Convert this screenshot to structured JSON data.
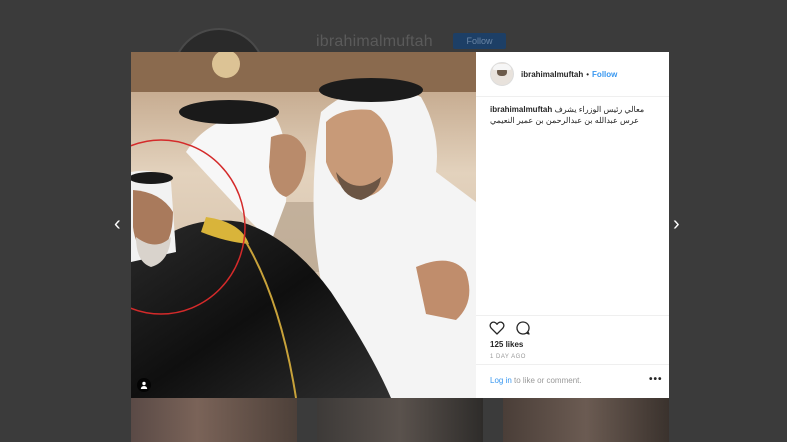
{
  "background": {
    "username": "ibrahimalmuftah",
    "follow_label": "Follow"
  },
  "post": {
    "username": "ibrahimalmuftah",
    "separator": "•",
    "follow_label": "Follow",
    "caption_username": "ibrahimalmuftah",
    "caption_text": "معالي رئيس الوزراء يشرف عرس عبدالله بن عبدالرحمن بن عمير النعيمي",
    "likes": "125 likes",
    "time": "1 DAY AGO",
    "login_link": "Log in",
    "login_rest": " to like or comment.",
    "more_label": "•••"
  },
  "nav": {
    "prev": "‹",
    "next": "›"
  },
  "photo": {
    "user_tag_icon": "user-icon",
    "annotation_color": "#d42a2a"
  }
}
